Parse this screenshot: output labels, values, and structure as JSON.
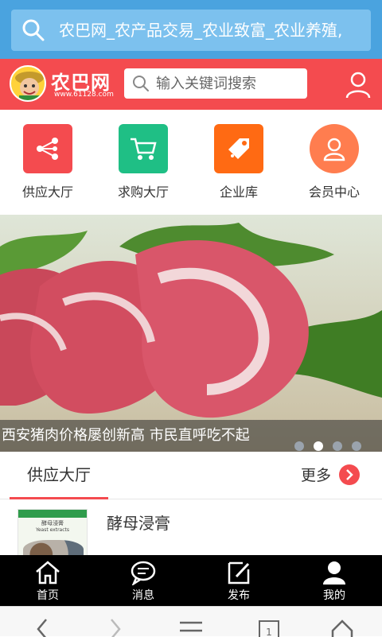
{
  "browser": {
    "url_text": "农巴网_农产品交易_农业致富_农业养殖,"
  },
  "header": {
    "logo_text": "农巴网",
    "logo_sub": "www.61128.com",
    "search_placeholder": "输入关键词搜索"
  },
  "quick_nav": [
    {
      "label": "供应大厅",
      "icon": "share-icon",
      "color": "#f44b4f"
    },
    {
      "label": "求购大厅",
      "icon": "cart-icon",
      "color": "#1fbf85"
    },
    {
      "label": "企业库",
      "icon": "tag-icon",
      "color": "#ff6a13"
    },
    {
      "label": "会员中心",
      "icon": "person-icon",
      "color": "#ff7d4f"
    }
  ],
  "banner": {
    "caption": "西安猪肉价格屡创新高 市民直呼吃不起",
    "active_slide": 2,
    "total_slides": 4
  },
  "section": {
    "title": "供应大厅",
    "more_label": "更多"
  },
  "list": [
    {
      "title": "酵母浸膏",
      "thumb_label": "酵母浸膏",
      "thumb_sub": "Yeast extracts"
    }
  ],
  "tabbar": [
    {
      "label": "首页",
      "icon": "home-icon"
    },
    {
      "label": "消息",
      "icon": "message-icon"
    },
    {
      "label": "发布",
      "icon": "edit-icon"
    },
    {
      "label": "我的",
      "icon": "person-icon"
    }
  ]
}
